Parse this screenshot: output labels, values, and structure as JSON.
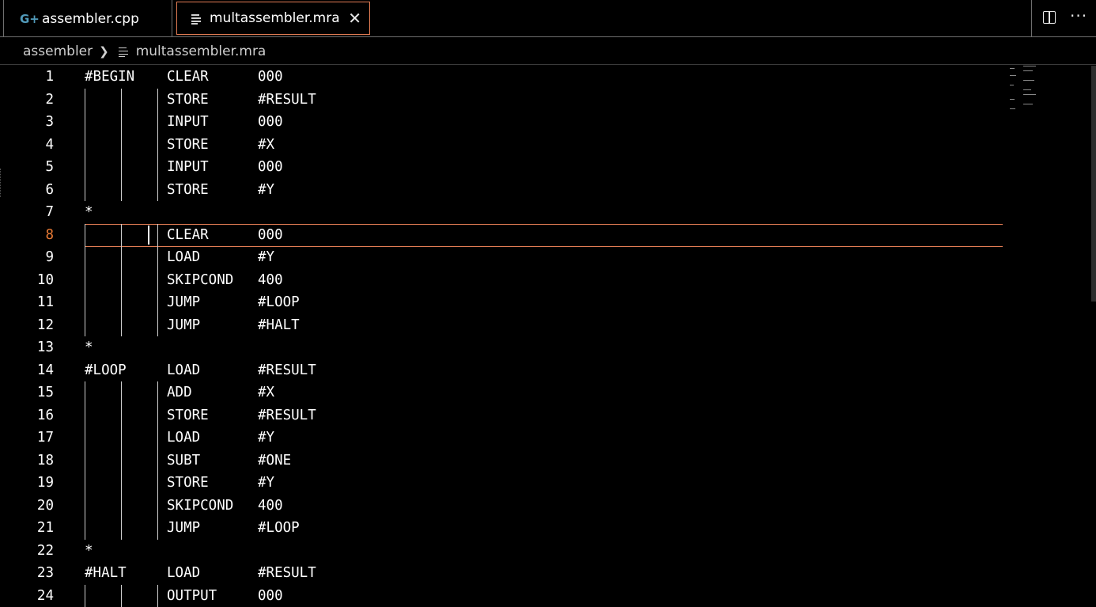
{
  "tabs": [
    {
      "label": "assembler.cpp",
      "icon": "cpp-file-icon",
      "active": false
    },
    {
      "label": "multassembler.mra",
      "icon": "text-file-icon",
      "active": true
    }
  ],
  "breadcrumb": {
    "folder": "assembler",
    "file": "multassembler.mra"
  },
  "editor": {
    "active_line": 8,
    "lines": [
      {
        "n": "1",
        "label": "#BEGIN",
        "op": "CLEAR",
        "arg": "000"
      },
      {
        "n": "2",
        "label": "",
        "op": "STORE",
        "arg": "#RESULT"
      },
      {
        "n": "3",
        "label": "",
        "op": "INPUT",
        "arg": "000"
      },
      {
        "n": "4",
        "label": "",
        "op": "STORE",
        "arg": "#X"
      },
      {
        "n": "5",
        "label": "",
        "op": "INPUT",
        "arg": "000"
      },
      {
        "n": "6",
        "label": "",
        "op": "STORE",
        "arg": "#Y"
      },
      {
        "n": "7",
        "label": "*",
        "op": "",
        "arg": ""
      },
      {
        "n": "8",
        "label": "",
        "op": "CLEAR",
        "arg": "000"
      },
      {
        "n": "9",
        "label": "",
        "op": "LOAD",
        "arg": "#Y"
      },
      {
        "n": "10",
        "label": "",
        "op": "SKIPCOND",
        "arg": "400"
      },
      {
        "n": "11",
        "label": "",
        "op": "JUMP",
        "arg": "#LOOP"
      },
      {
        "n": "12",
        "label": "",
        "op": "JUMP",
        "arg": "#HALT"
      },
      {
        "n": "13",
        "label": "*",
        "op": "",
        "arg": ""
      },
      {
        "n": "14",
        "label": "#LOOP",
        "op": "LOAD",
        "arg": "#RESULT"
      },
      {
        "n": "15",
        "label": "",
        "op": "ADD",
        "arg": "#X"
      },
      {
        "n": "16",
        "label": "",
        "op": "STORE",
        "arg": "#RESULT"
      },
      {
        "n": "17",
        "label": "",
        "op": "LOAD",
        "arg": "#Y"
      },
      {
        "n": "18",
        "label": "",
        "op": "SUBT",
        "arg": "#ONE"
      },
      {
        "n": "19",
        "label": "",
        "op": "STORE",
        "arg": "#Y"
      },
      {
        "n": "20",
        "label": "",
        "op": "SKIPCOND",
        "arg": "400"
      },
      {
        "n": "21",
        "label": "",
        "op": "JUMP",
        "arg": "#LOOP"
      },
      {
        "n": "22",
        "label": "*",
        "op": "",
        "arg": ""
      },
      {
        "n": "23",
        "label": "#HALT",
        "op": "LOAD",
        "arg": "#RESULT"
      },
      {
        "n": "24",
        "label": "",
        "op": "OUTPUT",
        "arg": "000"
      }
    ]
  },
  "colors": {
    "accent": "#e07b53",
    "active_line_number": "#e87a35",
    "cpp_icon": "#519aba",
    "background": "#000000"
  }
}
